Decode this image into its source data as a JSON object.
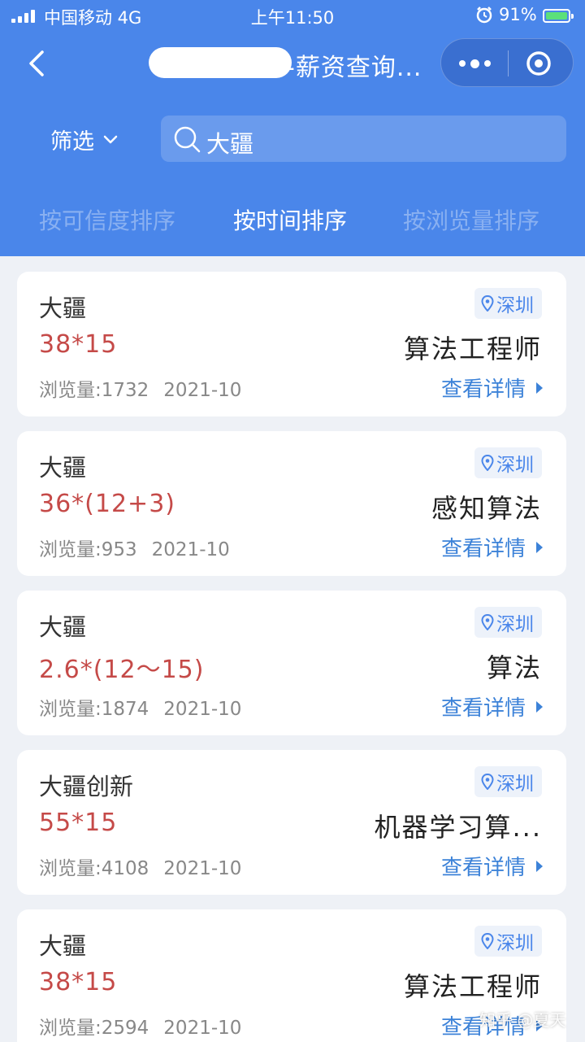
{
  "status_bar": {
    "carrier": "中国移动  4G",
    "time": "上午11:50",
    "battery": "91%"
  },
  "nav": {
    "title": "-薪资查询...",
    "back_icon": "chevron-left-icon",
    "more_icon": "more-dots-icon",
    "close_icon": "target-close-icon"
  },
  "filter": {
    "label": "筛选"
  },
  "search": {
    "query": "大疆"
  },
  "sort_tabs": [
    {
      "label": "按可信度排序",
      "active": false
    },
    {
      "label": "按时间排序",
      "active": true
    },
    {
      "label": "按浏览量排序",
      "active": false
    }
  ],
  "colors": {
    "header_bg": "#4a86ea",
    "salary": "#c54a48",
    "link": "#3c82d8"
  },
  "cards": [
    {
      "company": "大疆",
      "location": "深圳",
      "salary": "38*15",
      "job": "算法工程师",
      "views": "浏览量:1732",
      "date": "2021-10",
      "detail": "查看详情"
    },
    {
      "company": "大疆",
      "location": "深圳",
      "salary": "36*(12+3)",
      "job": "感知算法",
      "views": "浏览量:953",
      "date": "2021-10",
      "detail": "查看详情"
    },
    {
      "company": "大疆",
      "location": "深圳",
      "salary": "2.6*(12～15)",
      "job": "算法",
      "views": "浏览量:1874",
      "date": "2021-10",
      "detail": "查看详情"
    },
    {
      "company": "大疆创新",
      "location": "深圳",
      "salary": "55*15",
      "job": "机器学习算...",
      "views": "浏览量:4108",
      "date": "2021-10",
      "detail": "查看详情"
    },
    {
      "company": "大疆",
      "location": "深圳",
      "salary": "38*15",
      "job": "算法工程师",
      "views": "浏览量:2594",
      "date": "2021-10",
      "detail": "查看详情"
    }
  ],
  "watermark": "知乎 @夏天"
}
